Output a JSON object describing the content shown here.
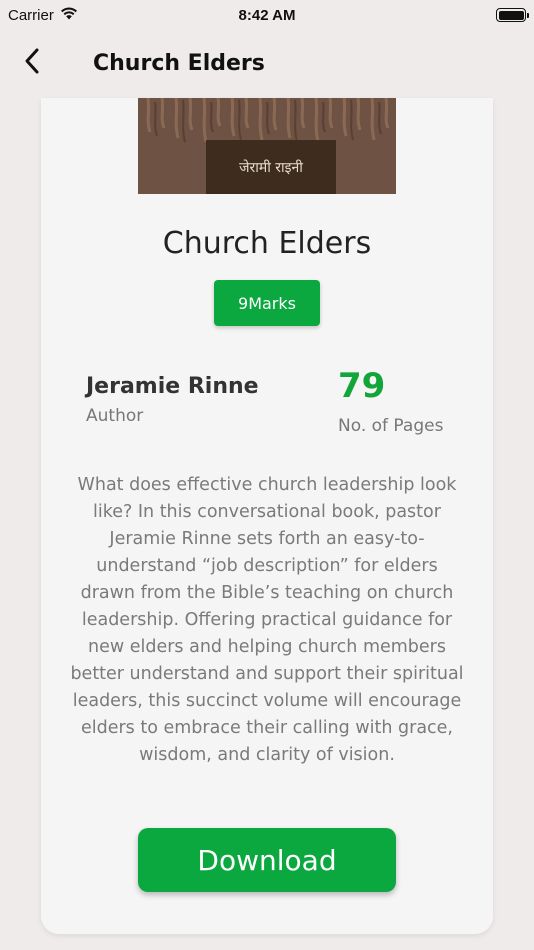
{
  "status_bar": {
    "carrier": "Carrier",
    "time": "8:42 AM",
    "wifi_icon": "wifi-icon",
    "battery_icon": "battery-icon",
    "battery_level": 1.0
  },
  "nav": {
    "title": "Church Elders",
    "back_icon": "chevron-left-icon"
  },
  "book": {
    "cover_text": "जेरामी राइनी",
    "title": "Church Elders",
    "publisher": "9Marks",
    "author": "Jeramie Rinne",
    "author_caption": "Author",
    "pages": "79",
    "pages_caption": "No. of Pages",
    "description": "What does effective church leadership look like? In this conversational book, pastor Jeramie Rinne sets forth an easy-to-understand “job description” for elders drawn from the Bible’s teaching on church leadership. Offering practical guidance for new elders and helping church members better understand and support their spiritual leaders, this succinct volume will encourage elders to embrace their calling with grace, wisdom, and clarity of vision.",
    "download_label": "Download"
  },
  "colors": {
    "accent_green": "#0aa83f",
    "pages_green": "#12a63a",
    "background": "#efebeb",
    "card": "#f6f5f5"
  }
}
